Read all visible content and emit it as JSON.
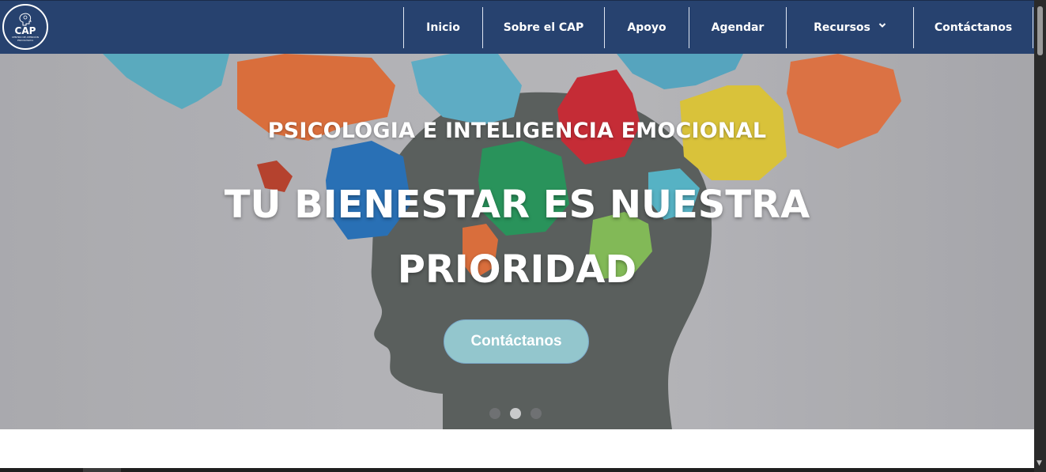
{
  "logo": {
    "text": "CAP",
    "subtext": "CENTRO DE ATENCIÓN PSICOLÓGICA"
  },
  "nav": {
    "items": [
      {
        "label": "Inicio"
      },
      {
        "label": "Sobre el CAP"
      },
      {
        "label": "Apoyo"
      },
      {
        "label": "Agendar"
      },
      {
        "label": "Recursos"
      },
      {
        "label": "Contáctanos"
      }
    ]
  },
  "hero": {
    "subtitle": "PSICOLOGIA E INTELIGENCIA EMOCIONAL",
    "headline": "TU BIENESTAR ES NUESTRA PRIORIDAD",
    "cta_label": "Contáctanos",
    "slides_total": 3,
    "active_slide": 2
  },
  "colors": {
    "nav_bg": "#27426f",
    "cta_bg": "#93c6cd",
    "text": "#ffffff"
  },
  "icons": {
    "logo_icon": "head-brain-icon",
    "dropdown": "chevron-down-icon"
  }
}
